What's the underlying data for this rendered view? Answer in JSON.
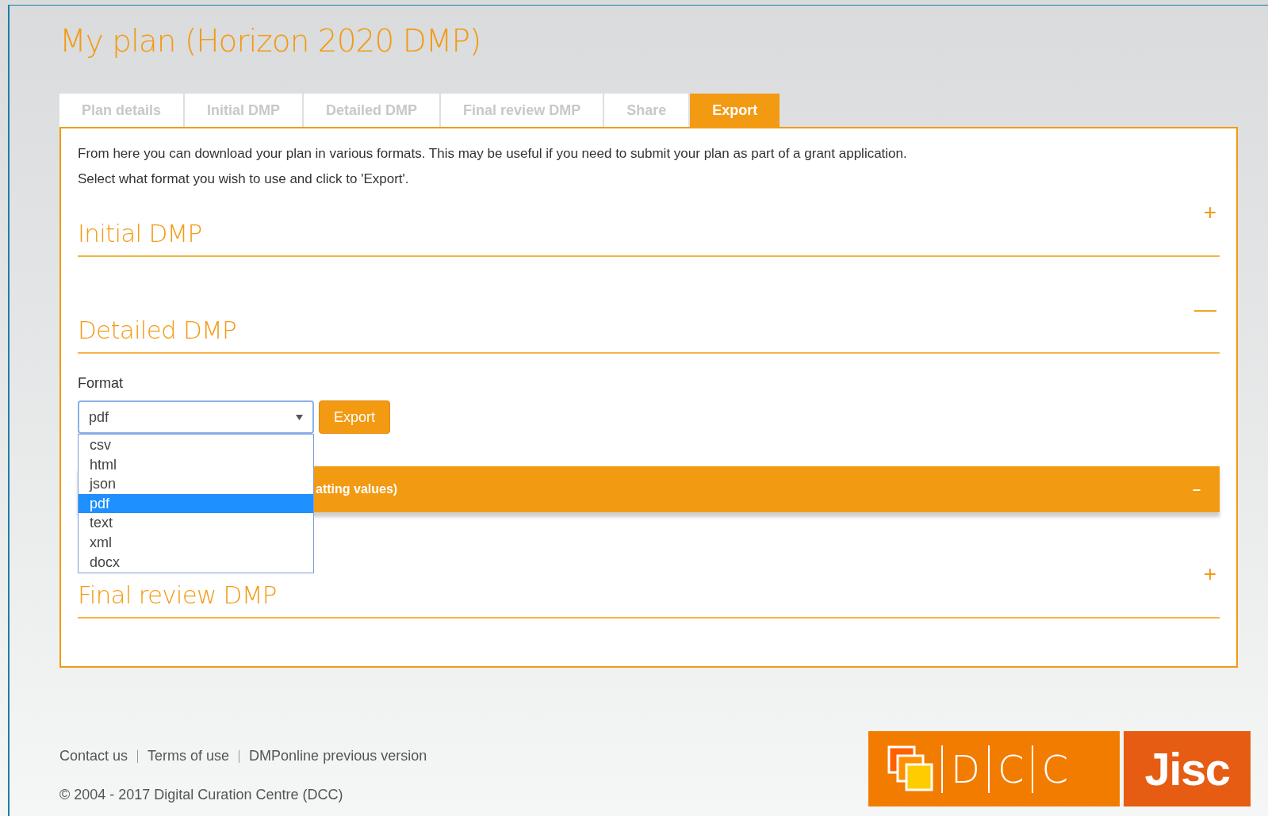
{
  "title": "My plan (Horizon 2020 DMP)",
  "tabs": [
    {
      "label": "Plan details",
      "selected": false
    },
    {
      "label": "Initial DMP",
      "selected": false
    },
    {
      "label": "Detailed DMP",
      "selected": false
    },
    {
      "label": "Final review DMP",
      "selected": false
    },
    {
      "label": "Share",
      "selected": false
    },
    {
      "label": "Export",
      "selected": true
    }
  ],
  "intro": [
    "From here you can download your plan in various formats. This may be useful if you need to submit your plan as part of a grant application.",
    "Select what format you wish to use and click to 'Export'."
  ],
  "sections": [
    {
      "heading": "Initial DMP",
      "toggle": "+"
    },
    {
      "heading": "Detailed DMP",
      "toggle": "—"
    },
    {
      "heading": "Final review DMP",
      "toggle": "+"
    }
  ],
  "format": {
    "label": "Format",
    "value": "pdf",
    "button": "Export",
    "options": [
      {
        "label": "csv",
        "selected": false
      },
      {
        "label": "html",
        "selected": false
      },
      {
        "label": "json",
        "selected": false
      },
      {
        "label": "pdf",
        "selected": true
      },
      {
        "label": "text",
        "selected": false
      },
      {
        "label": "xml",
        "selected": false
      },
      {
        "label": "docx",
        "selected": false
      }
    ]
  },
  "bar": {
    "text": "atting values)",
    "toggle": "–"
  },
  "footer": {
    "links": [
      "Contact us",
      "Terms of use",
      "DMPonline previous version"
    ],
    "copyright": "© 2004 - 2017 Digital Curation Centre (DCC)"
  },
  "logos": {
    "dcc": [
      "D",
      "C",
      "C"
    ],
    "jisc": "Jisc"
  }
}
